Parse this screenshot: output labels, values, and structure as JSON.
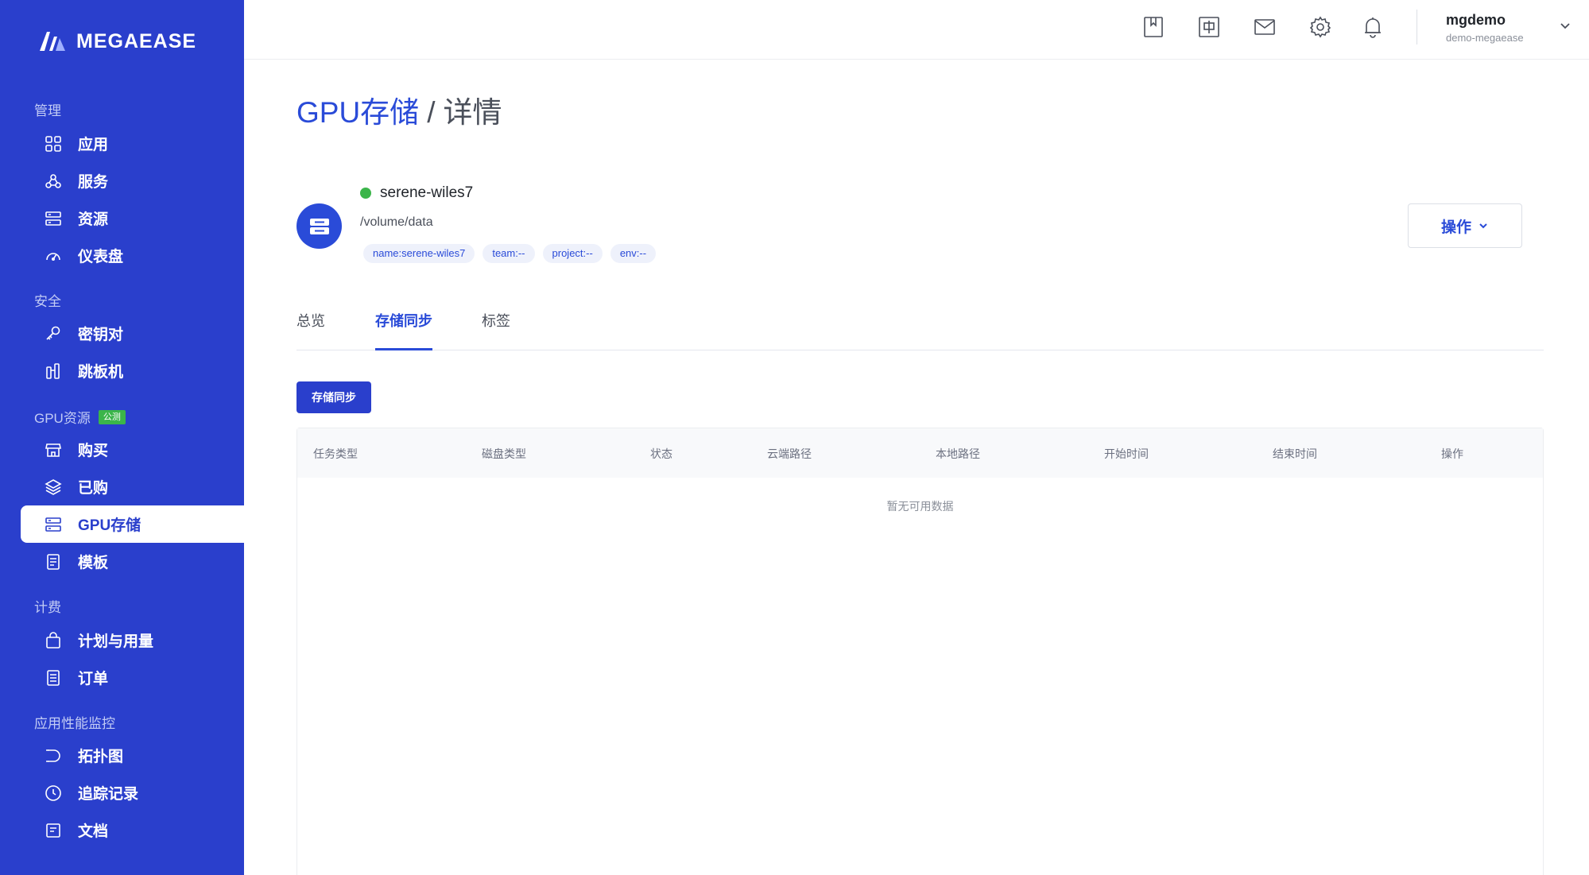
{
  "brand": {
    "name": "MEGAEASE"
  },
  "sidebar": {
    "sections": [
      {
        "title": "管理",
        "items": [
          {
            "label": "应用",
            "icon": "apps-grid-icon"
          },
          {
            "label": "服务",
            "icon": "services-icon"
          },
          {
            "label": "资源",
            "icon": "resources-icon"
          },
          {
            "label": "仪表盘",
            "icon": "dashboard-gauge-icon"
          }
        ]
      },
      {
        "title": "安全",
        "items": [
          {
            "label": "密钥对",
            "icon": "key-icon"
          },
          {
            "label": "跳板机",
            "icon": "jump-host-icon"
          }
        ]
      },
      {
        "title": "GPU资源",
        "badge": "公测",
        "items": [
          {
            "label": "购买",
            "icon": "store-icon"
          },
          {
            "label": "已购",
            "icon": "layers-icon"
          },
          {
            "label": "GPU存储",
            "icon": "storage-icon",
            "active": true
          },
          {
            "label": "模板",
            "icon": "template-icon"
          }
        ]
      },
      {
        "title": "计费",
        "items": [
          {
            "label": "计划与用量",
            "icon": "shopping-bag-icon"
          },
          {
            "label": "订单",
            "icon": "order-list-icon"
          }
        ]
      },
      {
        "title": "应用性能监控",
        "items": [
          {
            "label": "拓扑图",
            "icon": "topology-icon"
          },
          {
            "label": "追踪记录",
            "icon": "clock-icon"
          },
          {
            "label": "文档",
            "icon": "document-icon"
          }
        ]
      }
    ]
  },
  "topbar": {
    "icons": [
      "bookmark-icon",
      "language-zh-icon",
      "mail-icon",
      "gear-icon",
      "bell-icon"
    ],
    "user": {
      "name": "mgdemo",
      "org": "demo-megaease"
    }
  },
  "page": {
    "breadcrumb_link": "GPU存储",
    "breadcrumb_sep": "/",
    "breadcrumb_current": "详情"
  },
  "resource": {
    "name": "serene-wiles7",
    "path": "/volume/data",
    "status_color": "#3bb54a",
    "tags": [
      "name:serene-wiles7",
      "team:--",
      "project:--",
      "env:--"
    ]
  },
  "actions": {
    "label": "操作"
  },
  "tabs": [
    {
      "label": "总览",
      "active": false
    },
    {
      "label": "存储同步",
      "active": true
    },
    {
      "label": "标签",
      "active": false
    }
  ],
  "sync_button": {
    "label": "存储同步"
  },
  "table": {
    "columns": [
      "任务类型",
      "磁盘类型",
      "状态",
      "云端路径",
      "本地路径",
      "开始时间",
      "结束时间",
      "操作"
    ],
    "rows": [],
    "empty_text": "暂无可用数据"
  },
  "colors": {
    "sidebar_bg": "#2a3fcc",
    "accent": "#2a4bd8",
    "success": "#3bb54a"
  }
}
